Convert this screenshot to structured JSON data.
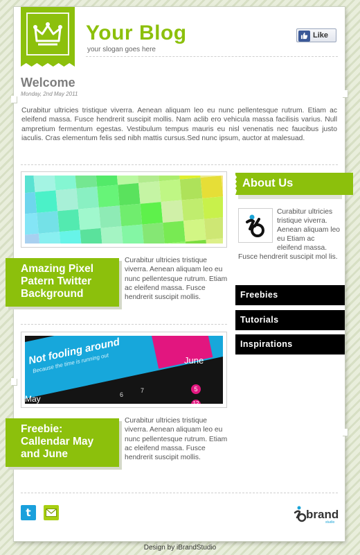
{
  "header": {
    "title": "Your Blog",
    "slogan": "your slogan goes here",
    "like_label": "Like",
    "logo_icon": "crown-icon"
  },
  "welcome": {
    "title": "Welcome",
    "date": "Monday, 2nd May 2011",
    "text": "Curabitur ultricies tristique viverra. Aenean aliquam leo eu nunc pellentesque rutrum. Etiam ac eleifend massa. Fusce hendrerit suscipit mollis. Nam aclib ero vehicula massa facilisis varius. Null ampretium fermentum egestas. Vestibulum tempus mauris eu nisl venenatis nec faucibus justo iaculis. Cras elementum felis sed nibh mattis cursus.Sed nunc ipsum, auctor at malesuad."
  },
  "posts": [
    {
      "title": "Amazing Pixel Patern Twitter Background",
      "excerpt": "Curabitur ultricies tristique viverra. Aenean aliquam leo eu nunc pellentesque rutrum. Etiam ac eleifend massa. Fusce hendrerit suscipit mollis."
    },
    {
      "title": "Freebie: Callendar May and June",
      "excerpt": "Curabitur ultricies tristique viverra. Aenean aliquam leo eu nunc pellentesque rutrum. Etiam ac eleifend massa. Fusce hendrerit suscipit mollis.",
      "image": {
        "headline": "Not fooling around",
        "tagline": "Because the time is running out",
        "month_june": "June",
        "month_may": "May",
        "numbers": [
          "6",
          "7",
          "5",
          "12"
        ]
      }
    }
  ],
  "sidebar": {
    "about_title": "About Us",
    "about_text": "Curabitur ultricies tristique viverra. Aenean aliquam leo eu Etiam ac eleifend massa. Fusce hendrerit suscipit mol lis.",
    "nav": [
      "Freebies",
      "Tutorials",
      "Inspirations"
    ]
  },
  "footer": {
    "credit": "Design by iBrandStudio",
    "brand": "brand",
    "brand_sub": "studio",
    "icons": [
      "twitter-icon",
      "email-icon"
    ]
  },
  "colors": {
    "accent": "#8cc00c",
    "nav_bg": "#000000",
    "text": "#555555"
  }
}
